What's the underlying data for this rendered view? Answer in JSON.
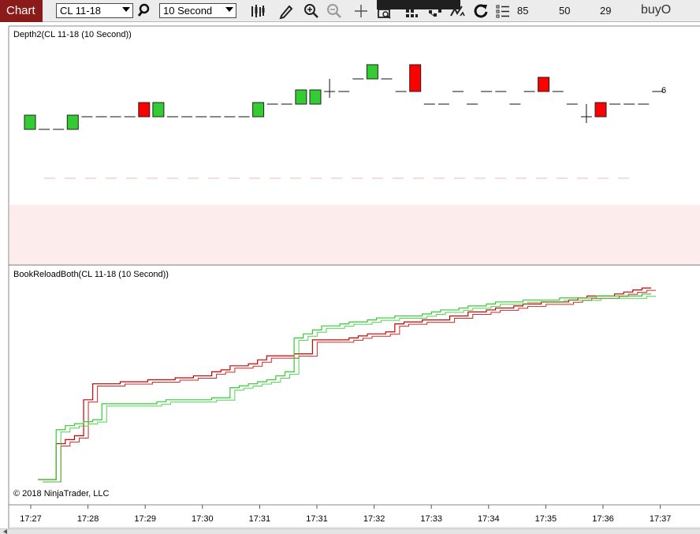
{
  "toolbar": {
    "chart_tab": "Chart",
    "instrument": "CL 11-18",
    "interval": "10 Second",
    "values": [
      "85",
      "50",
      "29"
    ],
    "strategy": "buyO",
    "icons": [
      "search-icon",
      "bar-style-icon",
      "pencil-draw-icon",
      "zoom-in-icon",
      "zoom-out-icon",
      "crosshair-icon",
      "data-box-icon",
      "order-entry-icon",
      "strategies-icon",
      "reload-icon",
      "properties-icon"
    ]
  },
  "colors": {
    "green": "#33cc33",
    "red": "#ff0000",
    "dark_red": "#cc0000",
    "tab_bg": "#8b1a1a",
    "pink_zone": "#fdecec"
  },
  "panels": {
    "depth": {
      "title": "Depth2(CL 11-18 (10 Second))",
      "count_label": "6"
    },
    "book": {
      "title": "BookReloadBoth(CL 11-18 (10 Second))"
    }
  },
  "copyright": "© 2018 NinjaTrader, LLC",
  "time_axis": [
    "17:27",
    "17:28",
    "17:29",
    "17:30",
    "17:31",
    "17:31",
    "17:32",
    "17:33",
    "17:34",
    "17:35",
    "17:36",
    "17:37"
  ],
  "chart_data": [
    {
      "type": "bar",
      "title": "Depth2(CL 11-18 (10 Second))",
      "bars": [
        {
          "level": 4,
          "height": 1,
          "color": "green"
        },
        {
          "level": 4,
          "height": 0,
          "color": "none"
        },
        {
          "level": 4,
          "height": 0,
          "color": "none"
        },
        {
          "level": 4,
          "height": 1,
          "color": "green"
        },
        {
          "level": 5,
          "height": 0,
          "color": "none"
        },
        {
          "level": 5,
          "height": 0,
          "color": "none"
        },
        {
          "level": 5,
          "height": 0,
          "color": "none"
        },
        {
          "level": 5,
          "height": 0,
          "color": "none"
        },
        {
          "level": 5,
          "height": 1,
          "color": "red"
        },
        {
          "level": 5,
          "height": 1,
          "color": "green"
        },
        {
          "level": 5,
          "height": 0,
          "color": "none"
        },
        {
          "level": 5,
          "height": 0,
          "color": "none"
        },
        {
          "level": 5,
          "height": 0,
          "color": "none"
        },
        {
          "level": 5,
          "height": 0,
          "color": "none"
        },
        {
          "level": 5,
          "height": 0,
          "color": "none"
        },
        {
          "level": 5,
          "height": 0,
          "color": "none"
        },
        {
          "level": 5,
          "height": 1,
          "color": "green"
        },
        {
          "level": 6,
          "height": 0,
          "color": "none"
        },
        {
          "level": 6,
          "height": 0,
          "color": "none"
        },
        {
          "level": 6,
          "height": 1,
          "color": "green"
        },
        {
          "level": 6,
          "height": 1,
          "color": "green"
        },
        {
          "level": 7,
          "height": 0,
          "color": "cross"
        },
        {
          "level": 7,
          "height": 0,
          "color": "none"
        },
        {
          "level": 8,
          "height": 0,
          "color": "none"
        },
        {
          "level": 8,
          "height": 1,
          "color": "green"
        },
        {
          "level": 8,
          "height": 0,
          "color": "none"
        },
        {
          "level": 7,
          "height": 0,
          "color": "none"
        },
        {
          "level": 7,
          "height": 2,
          "color": "red"
        },
        {
          "level": 6,
          "height": 0,
          "color": "none"
        },
        {
          "level": 6,
          "height": 0,
          "color": "none"
        },
        {
          "level": 7,
          "height": 0,
          "color": "none"
        },
        {
          "level": 6,
          "height": 0,
          "color": "none"
        },
        {
          "level": 7,
          "height": 0,
          "color": "none"
        },
        {
          "level": 7,
          "height": 0,
          "color": "none"
        },
        {
          "level": 6,
          "height": 0,
          "color": "none"
        },
        {
          "level": 7,
          "height": 0,
          "color": "none"
        },
        {
          "level": 7,
          "height": 1,
          "color": "red"
        },
        {
          "level": 7,
          "height": 0,
          "color": "none"
        },
        {
          "level": 6,
          "height": 0,
          "color": "none"
        },
        {
          "level": 5,
          "height": 0,
          "color": "cross"
        },
        {
          "level": 5,
          "height": 1,
          "color": "red"
        },
        {
          "level": 6,
          "height": 0,
          "color": "none"
        },
        {
          "level": 6,
          "height": 0,
          "color": "none"
        },
        {
          "level": 6,
          "height": 0,
          "color": "none"
        },
        {
          "level": 7,
          "height": 0,
          "color": "none"
        }
      ]
    },
    {
      "type": "line",
      "title": "BookReloadBoth(CL 11-18 (10 Second))",
      "series": [
        {
          "color": "red",
          "values": [
            0,
            0,
            18,
            20,
            22,
            40,
            48,
            48,
            48,
            49,
            49,
            49,
            50,
            50,
            50,
            51,
            51,
            52,
            52,
            54,
            55,
            57,
            57,
            58,
            60,
            62,
            62,
            62,
            63,
            63,
            70,
            70,
            70,
            70,
            71,
            72,
            73,
            73,
            74,
            78,
            79,
            79,
            80,
            80,
            80,
            82,
            82,
            84,
            84,
            85,
            86,
            86,
            87,
            88,
            88,
            89,
            89,
            89,
            90,
            91,
            92,
            92,
            92,
            93,
            94,
            95,
            96,
            96
          ]
        },
        {
          "color": "green",
          "values": [
            0,
            0,
            25,
            27,
            28,
            29,
            30,
            38,
            38,
            38,
            38,
            38,
            38,
            39,
            40,
            40,
            40,
            40,
            40,
            41,
            41,
            46,
            47,
            48,
            49,
            50,
            52,
            54,
            71,
            73,
            75,
            77,
            77,
            78,
            79,
            79,
            80,
            81,
            81,
            82,
            82,
            82,
            83,
            84,
            85,
            85,
            86,
            87,
            87,
            88,
            89,
            89,
            89,
            90,
            90,
            90,
            90,
            91,
            91,
            91,
            91,
            92,
            92,
            92,
            92,
            92,
            93,
            93
          ]
        }
      ]
    }
  ]
}
